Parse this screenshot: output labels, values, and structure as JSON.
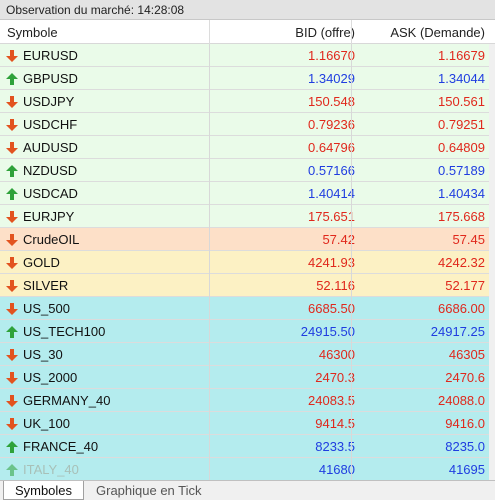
{
  "window": {
    "title": "Observation du marché: 14:28:08"
  },
  "columns": {
    "symbol": "Symbole",
    "bid": "BID (offre)",
    "ask": "ASK (Demande)"
  },
  "colors": {
    "down": "#e0281c",
    "up": "#1f3de0",
    "forex_bg": "#eafbe9",
    "oil_bg": "#fde0c8",
    "metal_bg": "#fcf1c4",
    "index_bg": "#b4ecee"
  },
  "rows": [
    {
      "symbol": "EURUSD",
      "bid": "1.16670",
      "ask": "1.16679",
      "dir": "down",
      "group": "forex"
    },
    {
      "symbol": "GBPUSD",
      "bid": "1.34029",
      "ask": "1.34044",
      "dir": "up",
      "group": "forex"
    },
    {
      "symbol": "USDJPY",
      "bid": "150.548",
      "ask": "150.561",
      "dir": "down",
      "group": "forex"
    },
    {
      "symbol": "USDCHF",
      "bid": "0.79236",
      "ask": "0.79251",
      "dir": "down",
      "group": "forex"
    },
    {
      "symbol": "AUDUSD",
      "bid": "0.64796",
      "ask": "0.64809",
      "dir": "down",
      "group": "forex"
    },
    {
      "symbol": "NZDUSD",
      "bid": "0.57166",
      "ask": "0.57189",
      "dir": "up",
      "group": "forex"
    },
    {
      "symbol": "USDCAD",
      "bid": "1.40414",
      "ask": "1.40434",
      "dir": "up",
      "group": "forex"
    },
    {
      "symbol": "EURJPY",
      "bid": "175.651",
      "ask": "175.668",
      "dir": "down",
      "group": "forex"
    },
    {
      "symbol": "CrudeOIL",
      "bid": "57.42",
      "ask": "57.45",
      "dir": "down",
      "group": "oil"
    },
    {
      "symbol": "GOLD",
      "bid": "4241.93",
      "ask": "4242.32",
      "dir": "down",
      "group": "metal"
    },
    {
      "symbol": "SILVER",
      "bid": "52.116",
      "ask": "52.177",
      "dir": "down",
      "group": "metal"
    },
    {
      "symbol": "US_500",
      "bid": "6685.50",
      "ask": "6686.00",
      "dir": "down",
      "group": "index"
    },
    {
      "symbol": "US_TECH100",
      "bid": "24915.50",
      "ask": "24917.25",
      "dir": "up",
      "group": "index"
    },
    {
      "symbol": "US_30",
      "bid": "46300",
      "ask": "46305",
      "dir": "down",
      "group": "index"
    },
    {
      "symbol": "US_2000",
      "bid": "2470.3",
      "ask": "2470.6",
      "dir": "down",
      "group": "index"
    },
    {
      "symbol": "GERMANY_40",
      "bid": "24083.5",
      "ask": "24088.0",
      "dir": "down",
      "group": "index"
    },
    {
      "symbol": "UK_100",
      "bid": "9414.5",
      "ask": "9416.0",
      "dir": "down",
      "group": "index"
    },
    {
      "symbol": "FRANCE_40",
      "bid": "8233.5",
      "ask": "8235.0",
      "dir": "up",
      "group": "index"
    },
    {
      "symbol": "ITALY_40",
      "bid": "41680",
      "ask": "41695",
      "dir": "up",
      "group": "index",
      "faded": true
    }
  ],
  "tabs": {
    "symbols": "Symboles",
    "tick_chart": "Graphique en Tick"
  }
}
